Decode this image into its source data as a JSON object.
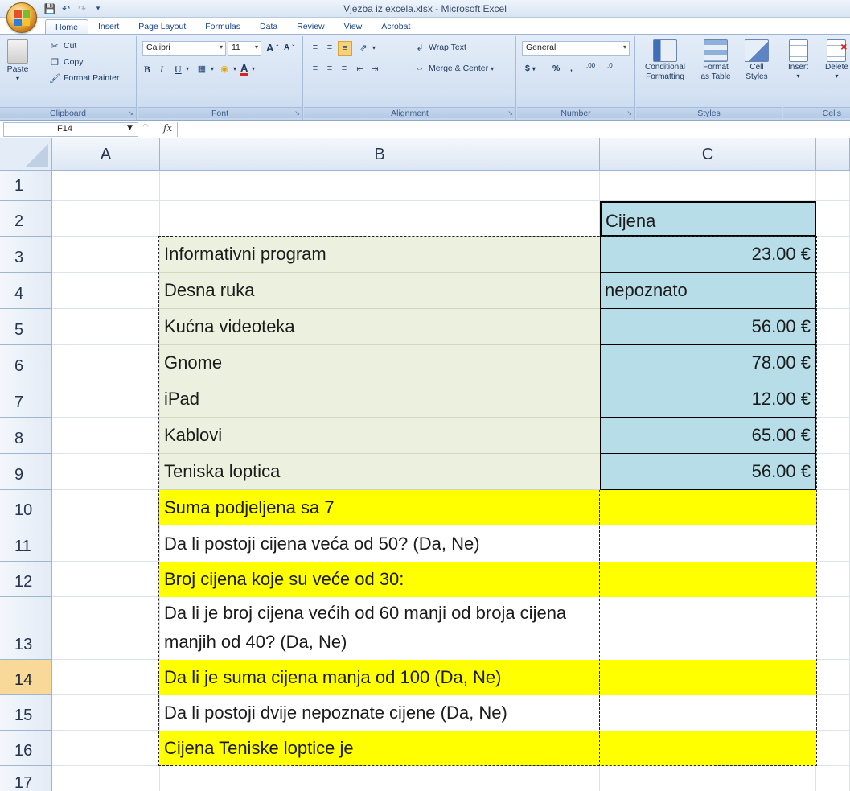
{
  "window": {
    "title": "Vjezba iz excela.xlsx - Microsoft Excel"
  },
  "ribbon": {
    "tabs": [
      {
        "label": "Home",
        "active": true
      },
      {
        "label": "Insert"
      },
      {
        "label": "Page Layout"
      },
      {
        "label": "Formulas"
      },
      {
        "label": "Data"
      },
      {
        "label": "Review"
      },
      {
        "label": "View"
      },
      {
        "label": "Acrobat"
      }
    ],
    "clipboard": {
      "label": "Clipboard",
      "paste": "Paste",
      "cut": "Cut",
      "copy": "Copy",
      "format_painter": "Format Painter"
    },
    "font": {
      "label": "Font",
      "font_name": "Calibri",
      "font_size": "11",
      "bold": "B",
      "italic": "I",
      "underline": "U",
      "grow": "A",
      "shrink": "A",
      "font_color": "A"
    },
    "alignment": {
      "label": "Alignment",
      "wrap_text": "Wrap Text",
      "merge_center": "Merge & Center"
    },
    "number": {
      "label": "Number",
      "format": "General",
      "currency": "$",
      "percent": "%",
      "comma": ",",
      "inc_decimal": ".00",
      "dec_decimal": ".0"
    },
    "styles": {
      "label": "Styles",
      "conditional": "Conditional",
      "conditional_2": "Formatting",
      "format_table": "Format",
      "format_table_2": "as Table",
      "cell_styles": "Cell",
      "cell_styles_2": "Styles"
    },
    "cells": {
      "label": "Cells",
      "insert": "Insert",
      "delete": "Delete"
    }
  },
  "formula_bar": {
    "name_box": "F14",
    "fx": "fx",
    "formula": ""
  },
  "sheet": {
    "columns": [
      "A",
      "B",
      "C"
    ],
    "rows": [
      "1",
      "2",
      "3",
      "4",
      "5",
      "6",
      "7",
      "8",
      "9",
      "10",
      "11",
      "12",
      "13",
      "14",
      "15",
      "16",
      "17"
    ],
    "selected_row": "14",
    "header": {
      "c": "Cijena"
    },
    "data": [
      {
        "row": "3",
        "b": "Informativni program",
        "c": "23.00 €"
      },
      {
        "row": "4",
        "b": "Desna ruka",
        "c": "nepoznato"
      },
      {
        "row": "5",
        "b": "Kućna videoteka",
        "c": "56.00 €"
      },
      {
        "row": "6",
        "b": "Gnome",
        "c": "78.00 €"
      },
      {
        "row": "7",
        "b": "iPad",
        "c": "12.00 €"
      },
      {
        "row": "8",
        "b": "Kablovi",
        "c": "65.00 €"
      },
      {
        "row": "9",
        "b": "Teniska loptica",
        "c": "56.00 €"
      }
    ],
    "questions": [
      {
        "row": "10",
        "b": "Suma podjeljena sa 7",
        "c": ""
      },
      {
        "row": "11",
        "b": "Da li postoji cijena veća od 50? (Da, Ne)",
        "c": ""
      },
      {
        "row": "12",
        "b": "Broj cijena koje su veće od 30:",
        "c": ""
      },
      {
        "row": "13",
        "b": "Da li je broj cijena većih od 60 manji od broja cijena manjih od 40? (Da, Ne)",
        "c": ""
      },
      {
        "row": "14",
        "b": "Da li je suma cijena manja od 100 (Da, Ne)",
        "c": ""
      },
      {
        "row": "15",
        "b": "Da li postoji dvije nepoznate cijene (Da, Ne)",
        "c": ""
      },
      {
        "row": "16",
        "b": "Cijena Teniske loptice je",
        "c": ""
      }
    ],
    "colors": {
      "green_fill": "#ebf1de",
      "blue_fill": "#b7dee8",
      "yellow_fill": "#ffff00",
      "selected_row_header": "#f9d99a"
    }
  }
}
